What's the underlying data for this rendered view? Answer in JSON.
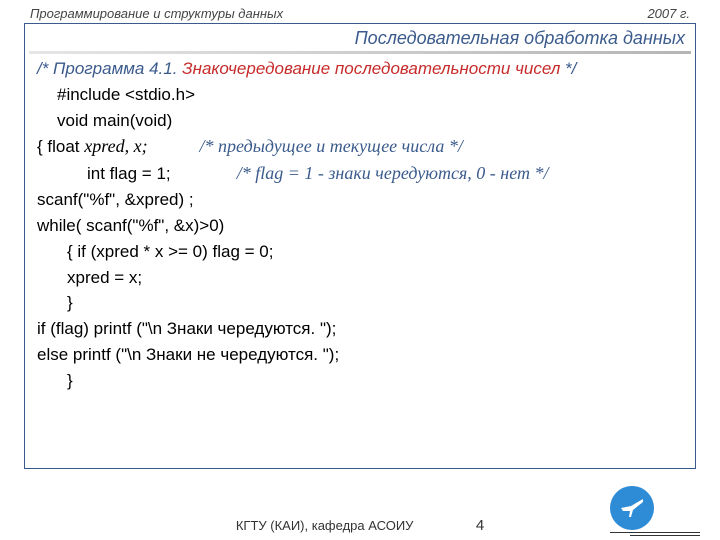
{
  "header": {
    "left": "Программирование  и структуры данных",
    "right": "2007 г."
  },
  "title": "Последовательная обработка данных",
  "code": {
    "c1a": "/* Программа 4.1. ",
    "c1b": "Знакочередование   последовательности чисел      ",
    "c1c": "*/",
    "l1": "#include <stdio.h>",
    "l2": "void main(void)",
    "l3pre": "{   float   ",
    "l3vars": "xpred, x;",
    "l3cmt": "/* предыдущее и текущее  числа                  */",
    "l4a": "int  flag = 1;",
    "l4cmt": "/* flag = 1 - знаки чередуются, 0 - нет  */",
    "l5": "scanf(\"%f\", &xpred) ;",
    "l6": "while( scanf(\"%f\", &x)>0)",
    "l7": "{    if (xpred * x >= 0) flag = 0;",
    "l8": "xpred = x;",
    "l9": "}",
    "l10": "if (flag) printf (\"\\n Знаки чередуются. \");",
    "l11": "else printf (\"\\n Знаки не чередуются. \");",
    "l12": "}"
  },
  "footer": {
    "org": "КГТУ   (КАИ),   кафедра АСОИУ",
    "page": "4"
  }
}
